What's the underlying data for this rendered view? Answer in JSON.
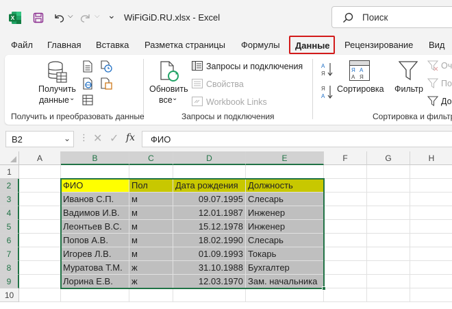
{
  "titlebar": {
    "filename": "WiFiGiD.RU.xlsx  -  Excel",
    "search_placeholder": "Поиск"
  },
  "tabs": [
    {
      "label": "Файл"
    },
    {
      "label": "Главная"
    },
    {
      "label": "Вставка"
    },
    {
      "label": "Разметка страницы"
    },
    {
      "label": "Формулы"
    },
    {
      "label": "Данные",
      "active": true
    },
    {
      "label": "Рецензирование"
    },
    {
      "label": "Вид"
    }
  ],
  "ribbon": {
    "get_data": {
      "line1": "Получить",
      "line2": "данные"
    },
    "refresh": {
      "line1": "Обновить",
      "line2": "все"
    },
    "queries": "Запросы и подключения",
    "properties": "Свойства",
    "workbook_links": "Workbook Links",
    "sort": "Сортировка",
    "filter": "Фильтр",
    "clear_partial": "Оч",
    "reapply_partial": "По",
    "advanced_partial": "До",
    "group_get": "Получить и преобразовать данные",
    "group_queries": "Запросы и подключения",
    "group_sort": "Сортировка и фильтр"
  },
  "formula_bar": {
    "name_box": "B2",
    "fx": "fx",
    "value": "ФИО"
  },
  "sheet": {
    "columns": [
      "A",
      "B",
      "C",
      "D",
      "E",
      "F",
      "G",
      "H"
    ],
    "rows": [
      "1",
      "2",
      "3",
      "4",
      "5",
      "6",
      "7",
      "8",
      "9",
      "10"
    ],
    "header": [
      "ФИО",
      "Пол",
      "Дата рождения",
      "Должность"
    ],
    "data": [
      [
        "Иванов С.П.",
        "м",
        "09.07.1995",
        "Слесарь"
      ],
      [
        "Вадимов И.В.",
        "м",
        "12.01.1987",
        "Инженер"
      ],
      [
        "Леонтьев В.С.",
        "м",
        "15.12.1978",
        "Инженер"
      ],
      [
        "Попов А.В.",
        "м",
        "18.02.1990",
        "Слесарь"
      ],
      [
        "Игорев Л.В.",
        "м",
        "01.09.1993",
        "Токарь"
      ],
      [
        "Муратова Т.М.",
        "ж",
        "31.10.1988",
        "Бухгалтер"
      ],
      [
        "Лорина Е.В.",
        "ж",
        "12.03.1970",
        "Зам. начальника"
      ]
    ],
    "colors": {
      "header_b": "#ffff00",
      "header_rest": "#c8c800",
      "body": "#bfbfbf",
      "accent": "#217346"
    }
  }
}
